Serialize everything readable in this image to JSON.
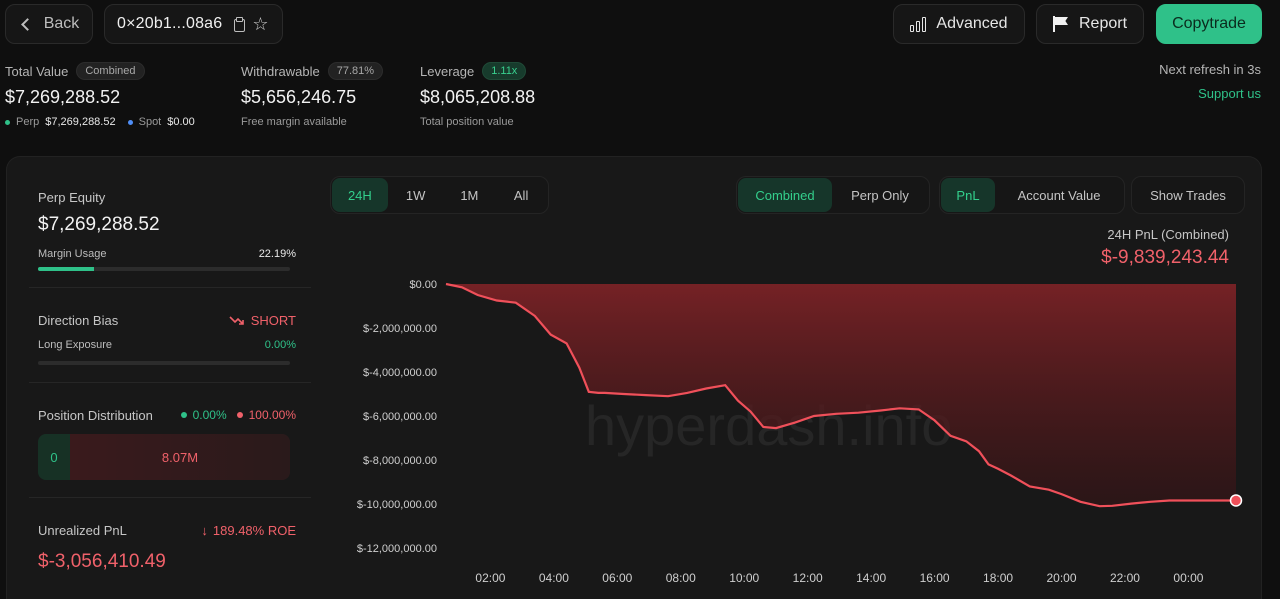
{
  "header": {
    "back_label": "Back",
    "address": "0×20b1...08a6",
    "advanced_label": "Advanced",
    "report_label": "Report",
    "copytrade_label": "Copytrade"
  },
  "stats": {
    "total_value": {
      "label": "Total Value",
      "badge": "Combined",
      "value": "$7,269,288.52",
      "perp_label": "Perp",
      "perp_value": "$7,269,288.52",
      "spot_label": "Spot",
      "spot_value": "$0.00",
      "perp_color": "#2fc189",
      "spot_color": "#4f8ef7"
    },
    "withdrawable": {
      "label": "Withdrawable",
      "badge": "77.81%",
      "value": "$5,656,246.75",
      "sub": "Free margin available"
    },
    "leverage": {
      "label": "Leverage",
      "badge": "1.11x",
      "value": "$8,065,208.88",
      "sub": "Total position value"
    },
    "refresh_text": "Next refresh in 3s",
    "support_text": "Support us"
  },
  "left": {
    "perp_equity_label": "Perp Equity",
    "perp_equity_value": "$7,269,288.52",
    "margin_usage_label": "Margin Usage",
    "margin_usage_value": "22.19%",
    "margin_usage_fraction": 0.2219,
    "direction_bias_label": "Direction Bias",
    "direction_bias_value": "SHORT",
    "long_exposure_label": "Long Exposure",
    "long_exposure_value": "0.00%",
    "long_exposure_fraction": 0.0,
    "position_distribution_label": "Position Distribution",
    "long_pct": "0.00%",
    "short_pct": "100.00%",
    "long_amount": "0",
    "short_amount": "8.07M",
    "unrealized_pnl_label": "Unrealized PnL",
    "roe_value": "189.48% ROE",
    "unrealized_pnl_value": "$-3,056,410.49"
  },
  "controls": {
    "timeframes": [
      "24H",
      "1W",
      "1M",
      "All"
    ],
    "active_timeframe": "24H",
    "scope": [
      "Combined",
      "Perp Only"
    ],
    "active_scope": "Combined",
    "metric": [
      "PnL",
      "Account Value"
    ],
    "active_metric": "PnL",
    "show_trades_label": "Show Trades"
  },
  "pnl_summary": {
    "title": "24H PnL (Combined)",
    "value": "$-9,839,243.44"
  },
  "watermark": "hyperdash.info",
  "colors": {
    "accent_green": "#2fc189",
    "loss_red": "#f0616a"
  },
  "chart_data": {
    "type": "area",
    "title": "24H PnL (Combined)",
    "xlabel": "",
    "ylabel": "",
    "x_ticks": [
      "02:00",
      "04:00",
      "06:00",
      "08:00",
      "10:00",
      "12:00",
      "14:00",
      "16:00",
      "18:00",
      "20:00",
      "22:00",
      "00:00"
    ],
    "y_ticks": [
      "$0.00",
      "$-2,000,000.00",
      "$-4,000,000.00",
      "$-6,000,000.00",
      "$-8,000,000.00",
      "$-10,000,000.00",
      "$-12,000,000.00"
    ],
    "y_tick_values": [
      0,
      -2000000,
      -4000000,
      -6000000,
      -8000000,
      -10000000,
      -12000000
    ],
    "ylim": [
      -12000000,
      0
    ],
    "x_range_hours": [
      1.0,
      1.8
    ],
    "series": [
      {
        "x": [
          1.0,
          1.5,
          2.0,
          2.6,
          3.2,
          3.8,
          4.3,
          4.8,
          5.2,
          5.5,
          5.8,
          6.0,
          6.6,
          7.3,
          8.0,
          8.6,
          9.2,
          9.8,
          10.2,
          10.6,
          11.0,
          11.4,
          12.0,
          12.6,
          13.3,
          14.0,
          14.7,
          15.3,
          15.9,
          16.4,
          16.9,
          17.4,
          17.8,
          18.1,
          18.4,
          18.8,
          19.4,
          20.0,
          20.4,
          21.0,
          21.6,
          22.0,
          22.6,
          23.2,
          23.8,
          24.4,
          25.0,
          25.6,
          25.9
        ],
        "y": [
          0,
          -150000,
          -500000,
          -750000,
          -850000,
          -1450000,
          -2300000,
          -2700000,
          -3800000,
          -4900000,
          -4950000,
          -4950000,
          -5000000,
          -5050000,
          -5100000,
          -4950000,
          -4750000,
          -4600000,
          -5300000,
          -5800000,
          -6500000,
          -6550000,
          -6300000,
          -6000000,
          -5900000,
          -5850000,
          -5750000,
          -5650000,
          -5700000,
          -6200000,
          -6900000,
          -7150000,
          -7600000,
          -8200000,
          -8400000,
          -8700000,
          -9200000,
          -9350000,
          -9550000,
          -9900000,
          -10100000,
          -10080000,
          -9980000,
          -9900000,
          -9840000,
          -9840000,
          -9840000,
          -9840000,
          -9839243
        ]
      }
    ],
    "last_value": -9839243.44,
    "grid": false,
    "legend": "none"
  }
}
